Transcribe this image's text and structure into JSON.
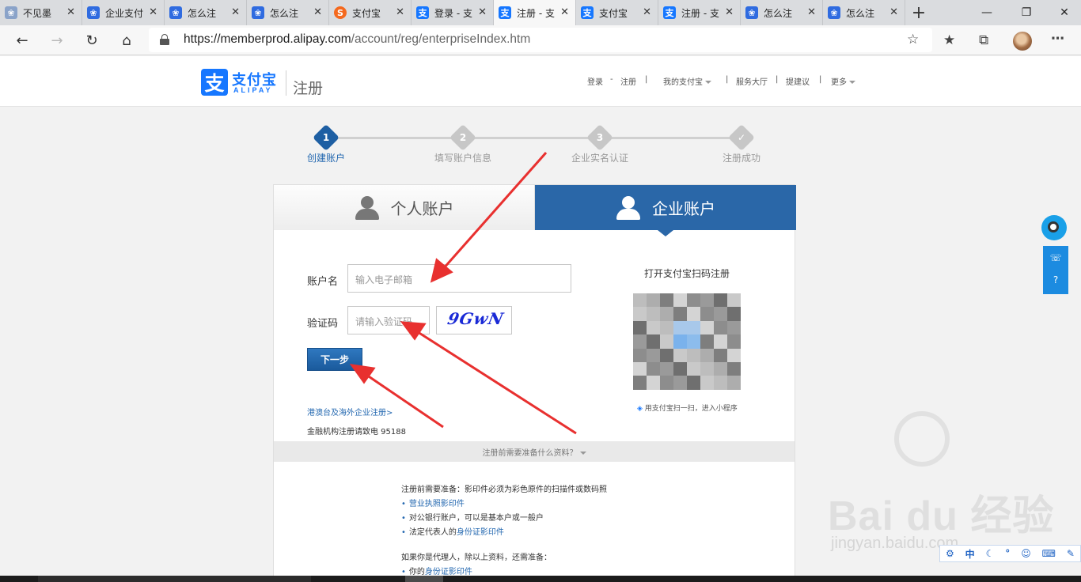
{
  "browser": {
    "tabs": [
      {
        "label": "不见墨",
        "icon": "baidu-paw-icon"
      },
      {
        "label": "企业支付",
        "icon": "baidu-paw-icon"
      },
      {
        "label": "怎么注",
        "icon": "baidu-paw-icon"
      },
      {
        "label": "怎么注",
        "icon": "baidu-paw-icon"
      },
      {
        "label": "支付宝",
        "icon": "sogou-icon"
      },
      {
        "label": "登录 - 支",
        "icon": "alipay-icon"
      },
      {
        "label": "注册 - 支",
        "icon": "alipay-icon",
        "active": true
      },
      {
        "label": "支付宝",
        "icon": "alipay-icon"
      },
      {
        "label": "注册 - 支",
        "icon": "alipay-icon"
      },
      {
        "label": "怎么注",
        "icon": "baidu-paw-icon"
      },
      {
        "label": "怎么注",
        "icon": "baidu-paw-icon"
      }
    ],
    "close_glyph": "✕",
    "new_tab_glyph": "+",
    "url_host": "https://memberprod.alipay.com",
    "url_path": "/account/reg/enterpriseIndex.htm"
  },
  "header": {
    "logo_mark": "支",
    "logo_cn": "支付宝",
    "logo_en": "ALIPAY",
    "section": "注册",
    "nav": {
      "login": "登录",
      "dash": "-",
      "register": "注册",
      "my_alipay": "我的支付宝",
      "service_hall": "服务大厅",
      "feedback": "提建议",
      "more": "更多",
      "sep": "|"
    }
  },
  "steps": [
    {
      "num": "1",
      "label": "创建账户",
      "active": true
    },
    {
      "num": "2",
      "label": "填写账户信息"
    },
    {
      "num": "3",
      "label": "企业实名认证"
    },
    {
      "num": "✓",
      "label": "注册成功"
    }
  ],
  "account_tabs": {
    "personal": "个人账户",
    "enterprise": "企业账户",
    "selected": "enterprise"
  },
  "form": {
    "account_label": "账户名",
    "account_placeholder": "输入电子邮箱",
    "captcha_label": "验证码",
    "captcha_placeholder": "请输入验证码",
    "captcha_image_text": "9GwN",
    "next_button": "下一步",
    "overseas_link": "港澳台及海外企业注册>",
    "finance_note": "金融机构注册请致电 95188"
  },
  "qr": {
    "title": "打开支付宝扫码注册",
    "hint": "用支付宝扫一扫，进入小程序"
  },
  "preparation": {
    "toggle": "注册前需要准备什么资料？",
    "intro": "注册前需要准备：影印件必须为彩色原件的扫描件或数码照",
    "item1_hl": "营业执照影印件",
    "item2": "对公银行账户，可以是基本户或一般户",
    "item3_pre": "法定代表人的",
    "item3_hl": "身份证影印件",
    "agent_intro": "如果你是代理人，除以上资料，还需准备：",
    "agent_item_pre": "你的",
    "agent_item_hl": "身份证影印件"
  },
  "watermark": {
    "main": "Bai du 经验",
    "sub": "jingyan.baidu.com"
  },
  "ime": {
    "mode": "中"
  },
  "colors": {
    "alipay_blue": "#1677ff",
    "enterprise_tab": "#2a67a8",
    "annotation_red": "#e8302f"
  }
}
